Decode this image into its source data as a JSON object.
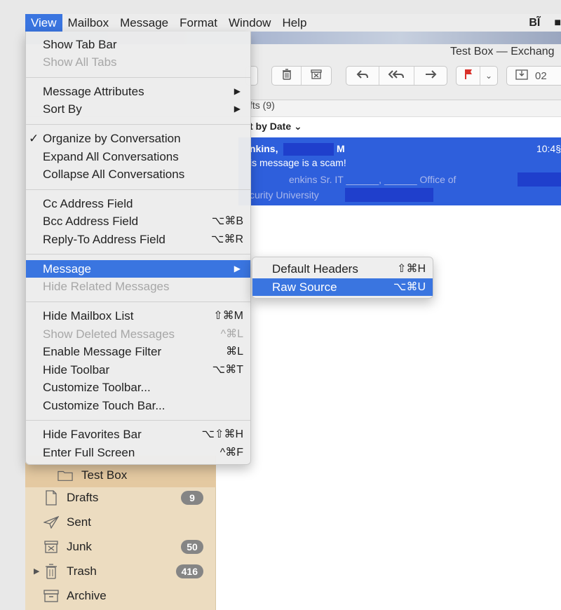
{
  "menubar": {
    "items": [
      "View",
      "Mailbox",
      "Message",
      "Format",
      "Window",
      "Help"
    ],
    "right_icons": [
      "BĨ",
      "■"
    ]
  },
  "window": {
    "title": "Test Box — Exchang",
    "toolbar": {
      "get_mail_count": "02"
    }
  },
  "message_list": {
    "header": "fts (9)",
    "sort": "t by Date ⌄",
    "selected_message": {
      "sender_partial": "nkins,",
      "sender_end": "M",
      "time": "10:4§",
      "subject": "is message is a scam!",
      "preview_line1": "enkins Sr. IT ______, ______ Office of",
      "preview_line2": "curity University"
    }
  },
  "view_menu": {
    "items": [
      {
        "label": "Show Tab Bar",
        "shortcut": "",
        "disabled": false
      },
      {
        "label": "Show All Tabs",
        "shortcut": "",
        "disabled": true
      },
      {
        "label": "Message Attributes",
        "shortcut": "▶",
        "disabled": false
      },
      {
        "label": "Sort By",
        "shortcut": "▶",
        "disabled": false
      },
      {
        "label": "Organize by Conversation",
        "shortcut": "",
        "checked": true,
        "disabled": false
      },
      {
        "label": "Expand All Conversations",
        "shortcut": "",
        "disabled": false
      },
      {
        "label": "Collapse All Conversations",
        "shortcut": "",
        "disabled": false
      },
      {
        "label": "Cc Address Field",
        "shortcut": "",
        "disabled": false
      },
      {
        "label": "Bcc Address Field",
        "shortcut": "⌥⌘B",
        "disabled": false
      },
      {
        "label": "Reply-To Address Field",
        "shortcut": "⌥⌘R",
        "disabled": false
      },
      {
        "label": "Message",
        "shortcut": "▶",
        "disabled": false,
        "highlighted": true
      },
      {
        "label": "Hide Related Messages",
        "shortcut": "",
        "disabled": true
      },
      {
        "label": "Hide Mailbox List",
        "shortcut": "⇧⌘M",
        "disabled": false
      },
      {
        "label": "Show Deleted Messages",
        "shortcut": "^⌘L",
        "disabled": true
      },
      {
        "label": "Enable Message Filter",
        "shortcut": "⌘L",
        "disabled": false
      },
      {
        "label": "Hide Toolbar",
        "shortcut": "⌥⌘T",
        "disabled": false
      },
      {
        "label": "Customize Toolbar...",
        "shortcut": "",
        "disabled": false
      },
      {
        "label": "Customize Touch Bar...",
        "shortcut": "",
        "disabled": false
      },
      {
        "label": "Hide Favorites Bar",
        "shortcut": "⌥⇧⌘H",
        "disabled": false
      },
      {
        "label": "Enter Full Screen",
        "shortcut": "^⌘F",
        "disabled": false
      }
    ]
  },
  "message_submenu": {
    "items": [
      {
        "label": "Default Headers",
        "shortcut": "⇧⌘H",
        "highlighted": false
      },
      {
        "label": "Raw Source",
        "shortcut": "⌥⌘U",
        "highlighted": true
      }
    ]
  },
  "sidebar": {
    "items": [
      {
        "label": "Test Box",
        "badge": "",
        "icon": "folder-icon",
        "selected": true
      },
      {
        "label": "Drafts",
        "badge": "9",
        "icon": "draft-icon"
      },
      {
        "label": "Sent",
        "badge": "",
        "icon": "paper-plane-icon"
      },
      {
        "label": "Junk",
        "badge": "50",
        "icon": "junk-icon"
      },
      {
        "label": "Trash",
        "badge": "416",
        "icon": "trash-icon"
      },
      {
        "label": "Archive",
        "badge": "",
        "icon": "archive-icon"
      }
    ]
  },
  "colors": {
    "highlight": "#3a75e0",
    "selection": "#2e5fdc",
    "sidebar_bg": "#ecdcc0",
    "badge": "#858585",
    "flag": "#d9302a"
  }
}
